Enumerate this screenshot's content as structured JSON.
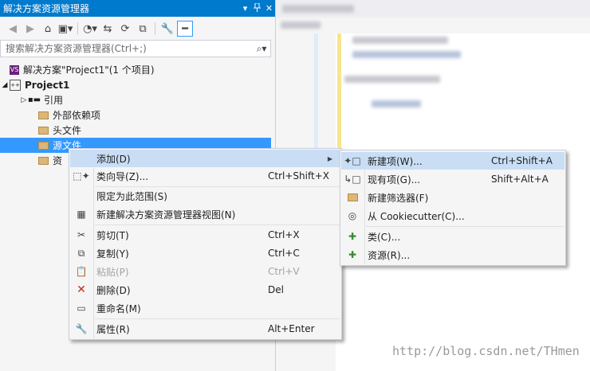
{
  "solution_explorer": {
    "title": "解决方案资源管理器",
    "title_buttons": {
      "dropdown": "▾",
      "pin": "📌",
      "close": "✕"
    },
    "search_placeholder": "搜索解决方案资源管理器(Ctrl+;)",
    "tree": {
      "solution_label": "解决方案\"Project1\"(1 个项目)",
      "project_label": "Project1",
      "references_label": "引用",
      "external_deps_label": "外部依赖项",
      "header_files_label": "头文件",
      "source_files_label": "源文件",
      "resource_files_label": "资"
    }
  },
  "context_menu": {
    "add": {
      "label": "添加(D)"
    },
    "class_wizard": {
      "label": "类向导(Z)...",
      "shortcut": "Ctrl+Shift+X"
    },
    "scope_to_this": {
      "label": "限定为此范围(S)"
    },
    "new_view": {
      "label": "新建解决方案资源管理器视图(N)"
    },
    "cut": {
      "label": "剪切(T)",
      "shortcut": "Ctrl+X"
    },
    "copy": {
      "label": "复制(Y)",
      "shortcut": "Ctrl+C"
    },
    "paste": {
      "label": "粘贴(P)",
      "shortcut": "Ctrl+V"
    },
    "delete": {
      "label": "删除(D)",
      "shortcut": "Del"
    },
    "rename": {
      "label": "重命名(M)"
    },
    "properties": {
      "label": "属性(R)",
      "shortcut": "Alt+Enter"
    }
  },
  "add_submenu": {
    "new_item": {
      "label": "新建项(W)...",
      "shortcut": "Ctrl+Shift+A"
    },
    "existing_item": {
      "label": "现有项(G)...",
      "shortcut": "Shift+Alt+A"
    },
    "new_filter": {
      "label": "新建筛选器(F)"
    },
    "from_cookiecutter": {
      "label": "从 Cookiecutter(C)..."
    },
    "class": {
      "label": "类(C)..."
    },
    "resource": {
      "label": "资源(R)..."
    }
  },
  "watermark": "http://blog.csdn.net/THmen",
  "colors": {
    "accent": "#007acc",
    "selection": "#3399ff",
    "menu_highlight": "#c9def5"
  }
}
